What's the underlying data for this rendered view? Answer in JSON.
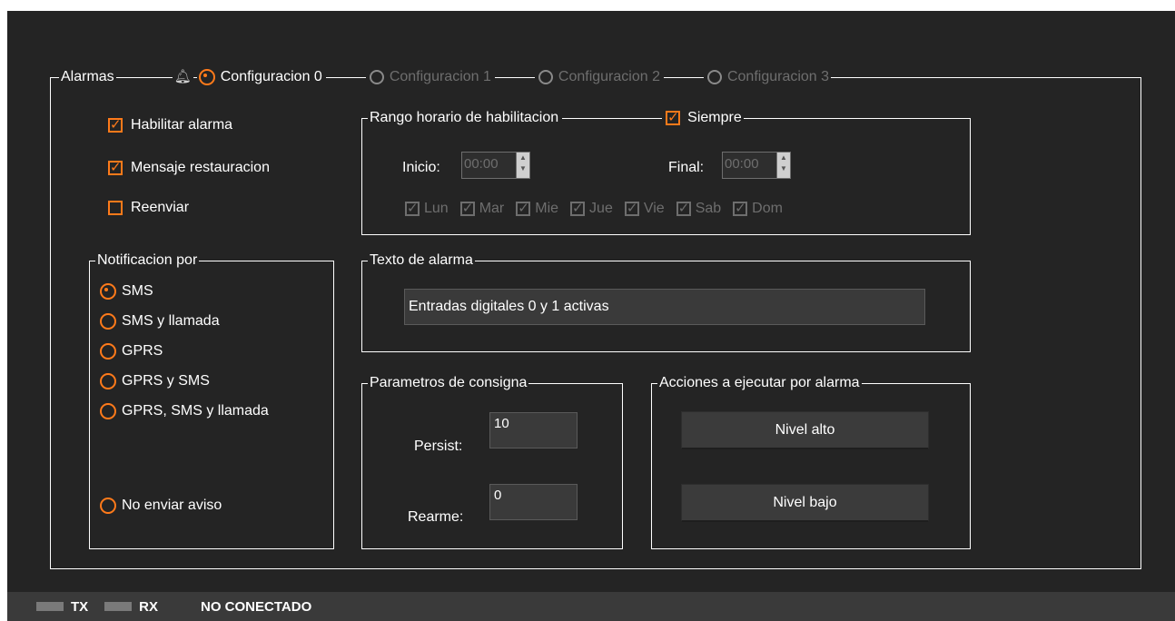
{
  "alarms": {
    "title": "Alarmas",
    "configs": [
      {
        "label": "Configuracion 0",
        "selected": true
      },
      {
        "label": "Configuracion 1",
        "selected": false
      },
      {
        "label": "Configuracion 2",
        "selected": false
      },
      {
        "label": "Configuracion 3",
        "selected": false
      }
    ]
  },
  "options": {
    "enable_alarm": {
      "label": "Habilitar alarma",
      "checked": true
    },
    "restore_message": {
      "label": "Mensaje restauracion",
      "checked": true
    },
    "resend": {
      "label": "Reenviar",
      "checked": false
    }
  },
  "schedule": {
    "title": "Rango horario de habilitacion",
    "always": {
      "label": "Siempre",
      "checked": true
    },
    "start_label": "Inicio:",
    "start_value": "00:00",
    "end_label": "Final:",
    "end_value": "00:00",
    "days": [
      "Lun",
      "Mar",
      "Mie",
      "Jue",
      "Vie",
      "Sab",
      "Dom"
    ]
  },
  "notification": {
    "title": "Notificacion por",
    "options": [
      "SMS",
      "SMS y llamada",
      "GPRS",
      "GPRS y SMS",
      "GPRS, SMS y llamada"
    ],
    "selected": "SMS",
    "no_notice": "No enviar aviso"
  },
  "alarm_text": {
    "title": "Texto de alarma",
    "value": "Entradas digitales 0 y 1 activas"
  },
  "setpoint": {
    "title": "Parametros de consigna",
    "persist_label": "Persist:",
    "persist_value": "10",
    "rearm_label": "Rearme:",
    "rearm_value": "0"
  },
  "actions": {
    "title": "Acciones a ejecutar por alarma",
    "high_label": "Nivel alto",
    "low_label": "Nivel bajo"
  },
  "status": {
    "tx": "TX",
    "rx": "RX",
    "connection": "NO CONECTADO"
  },
  "colors": {
    "accent": "#ff7a1a",
    "background": "#242424",
    "disabled": "#6e6e6e"
  }
}
